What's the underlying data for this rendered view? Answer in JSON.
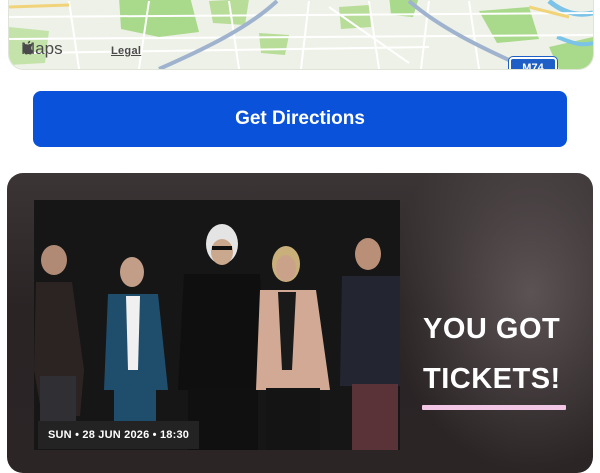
{
  "map": {
    "brand_label": "Maps",
    "legal_label": "Legal",
    "road_shield_label": "M74",
    "icons": [
      "apple-logo-icon"
    ]
  },
  "directions": {
    "button_label": "Get Directions",
    "accent_color": "#0a52d9"
  },
  "ticket": {
    "event_date": "SUN • 28 JUN 2026 • 18:30",
    "headline_line1": "YOU GOT",
    "headline_line2": "TICKETS!",
    "underline_color": "#f3c6e6"
  }
}
